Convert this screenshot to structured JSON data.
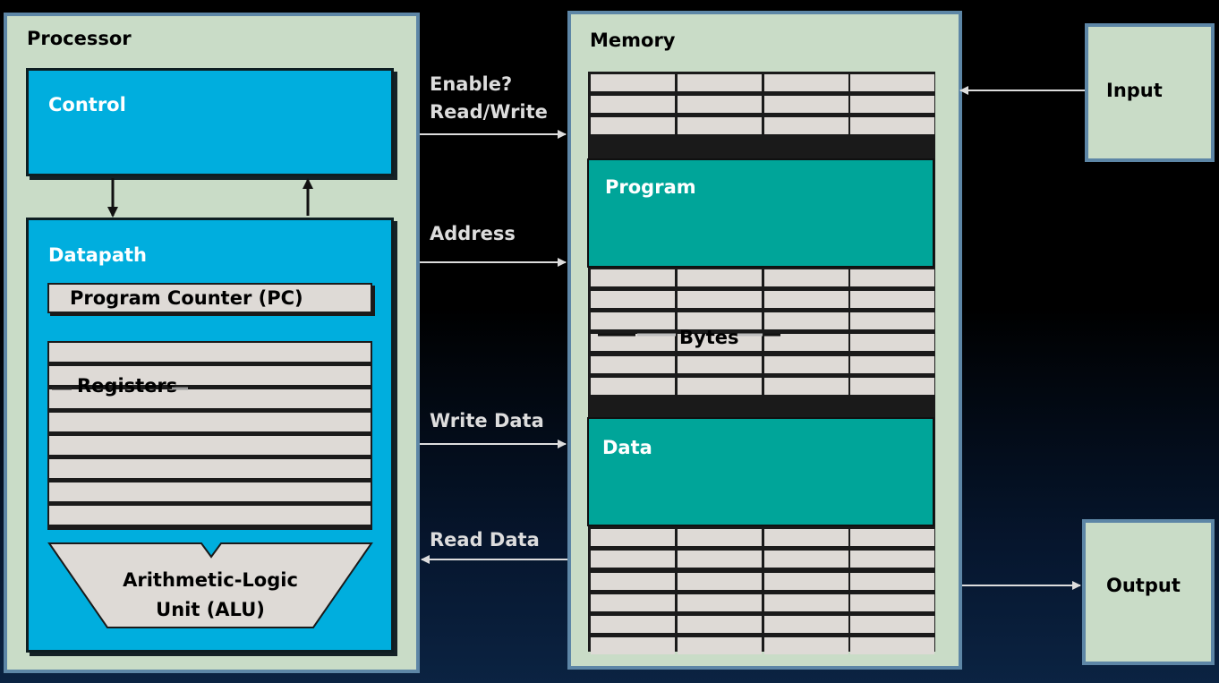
{
  "processor": {
    "title": "Processor",
    "control_label": "Control",
    "datapath": {
      "title": "Datapath",
      "pc_label": "Program Counter (PC)",
      "registers_label": "Registers",
      "alu_label_line1": "Arithmetic-Logic",
      "alu_label_line2": "Unit (ALU)"
    }
  },
  "memory": {
    "title": "Memory",
    "program_label": "Program",
    "bytes_label": "Bytes",
    "data_label": "Data"
  },
  "io": {
    "input_label": "Input",
    "output_label": "Output"
  },
  "signals": {
    "enable": "Enable?",
    "read_write": "Read/Write",
    "address": "Address",
    "write_data": "Write Data",
    "read_data": "Read Data"
  },
  "colors": {
    "panel": "#c9dcc7",
    "panel_border": "#5d86a6",
    "blue": "#00aede",
    "teal": "#00a599",
    "cell": "#dedad6"
  }
}
